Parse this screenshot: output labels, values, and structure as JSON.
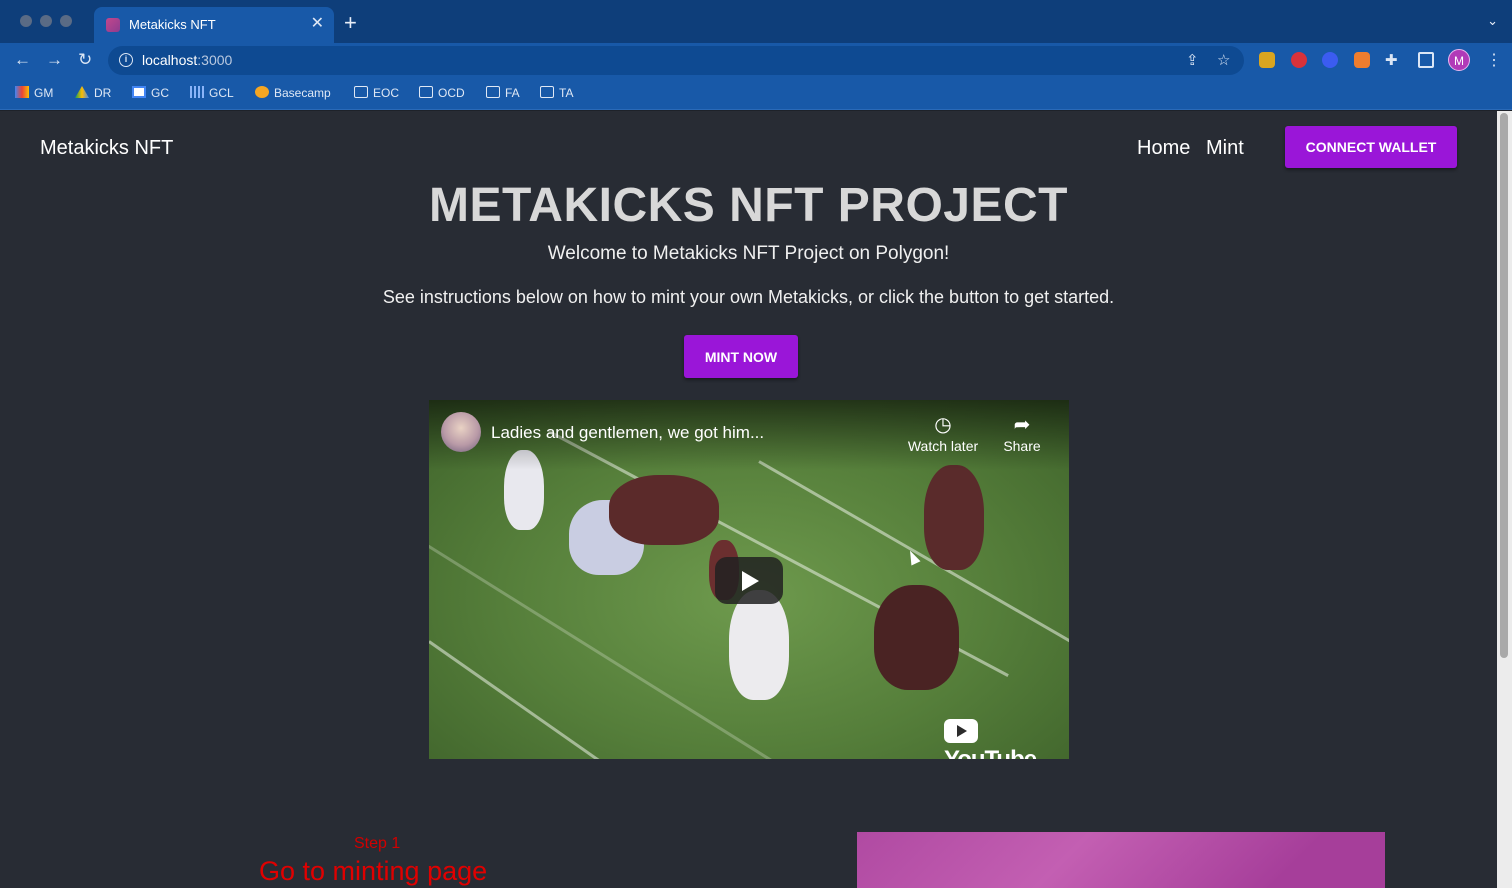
{
  "browser": {
    "tab_title": "Metakicks NFT",
    "tab_close": "✕",
    "new_tab": "+",
    "tab_menu": "⌄",
    "url_host": "localhost",
    "url_port": ":3000",
    "profile_initial": "M",
    "bookmarks": [
      {
        "label": "GM",
        "icon": "gmail-icon"
      },
      {
        "label": "DR",
        "icon": "drive-icon"
      },
      {
        "label": "GC",
        "icon": "calendar-icon"
      },
      {
        "label": "GCL",
        "icon": "classroom-icon"
      },
      {
        "label": "Basecamp",
        "icon": "basecamp-icon"
      },
      {
        "label": "EOC",
        "icon": "folder-icon"
      },
      {
        "label": "OCD",
        "icon": "folder-icon"
      },
      {
        "label": "FA",
        "icon": "folder-icon"
      },
      {
        "label": "TA",
        "icon": "folder-icon"
      }
    ]
  },
  "site": {
    "brand": "Metakicks NFT",
    "nav": {
      "home": "Home",
      "mint": "Mint"
    },
    "connect_button": "CONNECT WALLET",
    "hero_title": "METAKICKS NFT PROJECT",
    "welcome": "Welcome to Metakicks NFT Project on Polygon!",
    "instructions": "See instructions below on how to mint your own Metakicks, or click the button to get started.",
    "mint_button": "MINT NOW",
    "video": {
      "title": "Ladies and gentlemen, we got him...",
      "watch_later": "Watch later",
      "share": "Share",
      "logo": "YouTube"
    },
    "step": {
      "label": "Step 1",
      "title": "Go to minting page"
    }
  },
  "colors": {
    "accent": "#9a16d8",
    "page_bg": "#282c34",
    "step_text": "#e00000",
    "chrome_bg": "#1859a8"
  }
}
